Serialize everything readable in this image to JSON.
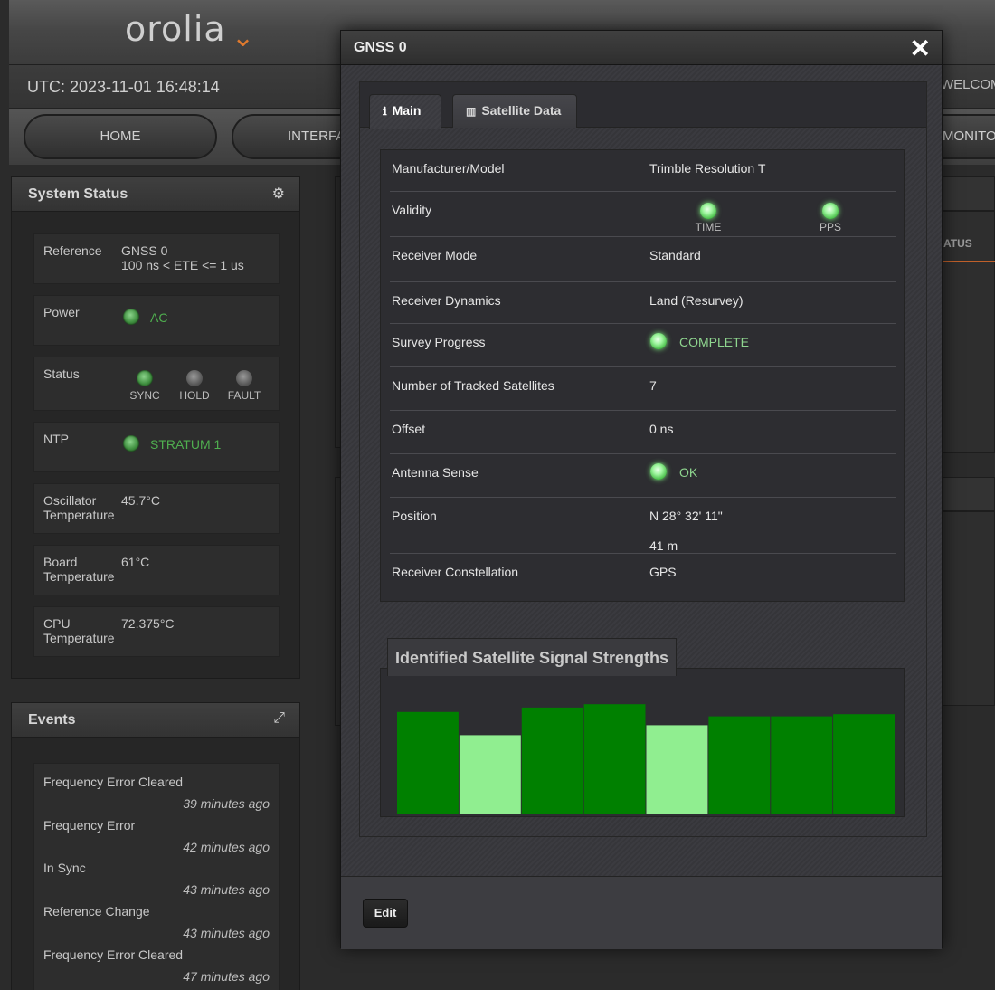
{
  "header": {
    "logo": "orolia",
    "utc": "UTC: 2023-11-01 16:48:14",
    "welcome": "WELCOME"
  },
  "nav": {
    "home": "HOME",
    "interfaces": "INTERFACES",
    "monitoring": "MONITORING"
  },
  "system_status": {
    "title": "System Status",
    "reference": {
      "label": "Reference",
      "line1": "GNSS 0",
      "line2": "100 ns < ETE <= 1 us"
    },
    "power": {
      "label": "Power",
      "value": "AC"
    },
    "status": {
      "label": "Status",
      "sync": "SYNC",
      "hold": "HOLD",
      "fault": "FAULT"
    },
    "ntp": {
      "label": "NTP",
      "value": "STRATUM 1"
    },
    "oscillator": {
      "label1": "Oscillator",
      "label2": "Temperature",
      "value": "45.7°C"
    },
    "board": {
      "label1": "Board",
      "label2": "Temperature",
      "value": "61°C"
    },
    "cpu": {
      "label1": "CPU",
      "label2": "Temperature",
      "value": "72.375°C"
    }
  },
  "events": {
    "title": "Events",
    "items": [
      {
        "text": "Frequency Error Cleared",
        "time": "39 minutes ago"
      },
      {
        "text": "Frequency Error",
        "time": "42 minutes ago"
      },
      {
        "text": "In Sync",
        "time": "43 minutes ago"
      },
      {
        "text": "Reference Change",
        "time": "43 minutes ago"
      },
      {
        "text": "Frequency Error Cleared",
        "time": "47 minutes ago"
      }
    ]
  },
  "modal": {
    "title": "GNSS 0",
    "close": "✕",
    "tabs": {
      "main": "Main",
      "satellite": "Satellite Data"
    },
    "rows": {
      "manufacturer": {
        "label": "Manufacturer/Model",
        "value": "Trimble Resolution T"
      },
      "validity": {
        "label": "Validity",
        "time": "TIME",
        "pps": "PPS"
      },
      "receiver_mode": {
        "label": "Receiver Mode",
        "value": "Standard"
      },
      "receiver_dynamics": {
        "label": "Receiver Dynamics",
        "value": "Land (Resurvey)"
      },
      "survey_progress": {
        "label": "Survey Progress",
        "value": "COMPLETE"
      },
      "tracked": {
        "label": "Number of Tracked Satellites",
        "value": "7"
      },
      "offset": {
        "label": "Offset",
        "value": "0 ns"
      },
      "antenna": {
        "label": "Antenna Sense",
        "value": "OK"
      },
      "position": {
        "label": "Position",
        "value1": "N 28° 32' 11\"",
        "value2": "41 m"
      },
      "constellation": {
        "label": "Receiver Constellation",
        "value": "GPS"
      }
    },
    "chart_title": "Identified Satellite Signal Strengths",
    "edit": "Edit"
  },
  "chart_data": {
    "type": "bar",
    "title": "Identified Satellite Signal Strengths",
    "values": [
      0.92,
      0.71,
      0.96,
      0.99,
      0.8,
      0.88,
      0.88,
      0.9
    ],
    "colors": [
      "#008000",
      "#90ee90",
      "#008000",
      "#008000",
      "#90ee90",
      "#008000",
      "#008000",
      "#008000"
    ],
    "ylim": [
      0,
      1
    ],
    "grid": false
  }
}
